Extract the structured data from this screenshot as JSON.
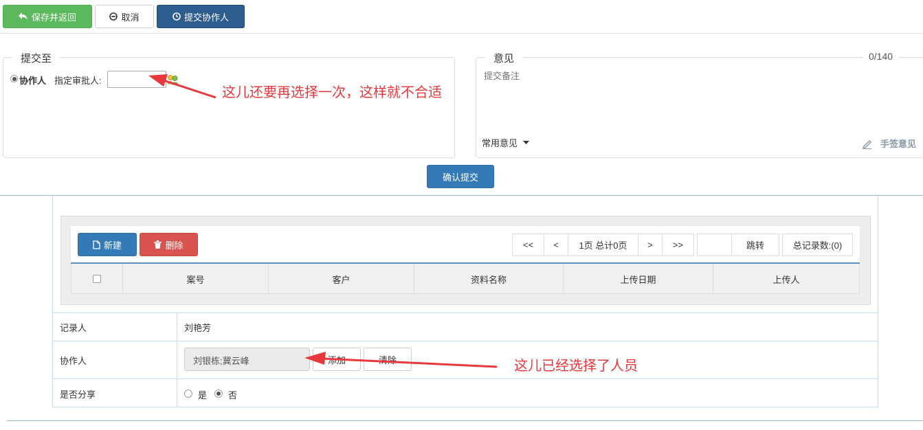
{
  "toolbar": {
    "save_return": "保存并返回",
    "cancel": "取消",
    "submit_collaborator": "提交协作人"
  },
  "submit_to": {
    "legend": "提交至",
    "radio_label": "协作人",
    "approver_label": "指定审批人:",
    "approver_value": ""
  },
  "opinion": {
    "legend": "意见",
    "counter": "0/140",
    "placeholder": "提交备注",
    "common_label": "常用意见",
    "handwritten_label": "手签意见"
  },
  "confirm_label": "确认提交",
  "annotations": {
    "top": "这儿还要再选择一次，这样就不合适",
    "bottom": "这儿已经选择了人员"
  },
  "grid": {
    "new_label": "新建",
    "delete_label": "删除",
    "pager": {
      "first": "<<",
      "prev": "<",
      "status": "1页 总计0页",
      "next": ">",
      "last": ">>",
      "jump_value": "",
      "jump_label": "跳转",
      "total_records": "总记录数:(0)"
    },
    "columns": [
      "案号",
      "客户",
      "资料名称",
      "上传日期",
      "上传人"
    ]
  },
  "form": {
    "recorder_label": "记录人",
    "recorder_value": "刘艳芳",
    "collaborator_label": "协作人",
    "collaborator_value": "刘银栋;冀云峰",
    "add_label": "添加",
    "clear_label": "清除",
    "share_label": "是否分享",
    "share_yes": "是",
    "share_no": "否",
    "share_selected": "否"
  },
  "colors": {
    "success": "#5cb85c",
    "navy": "#2d5c8e",
    "primary": "#337ab7",
    "danger": "#d9534f",
    "annotation": "#e8383d"
  }
}
